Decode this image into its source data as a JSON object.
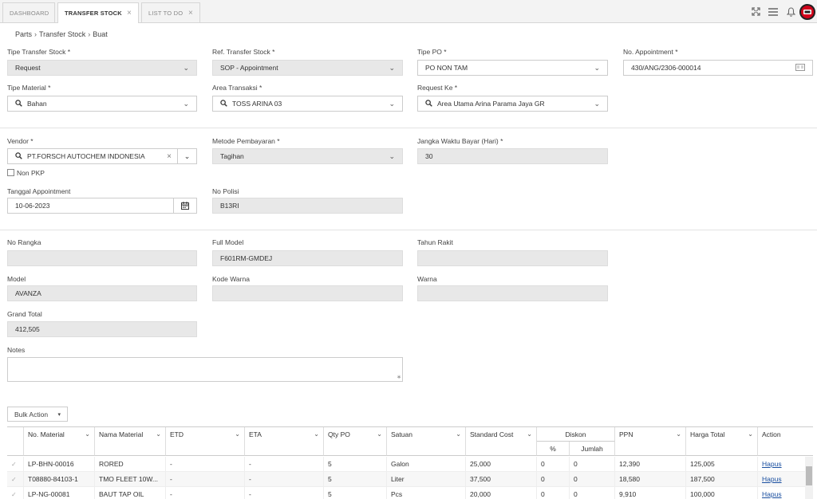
{
  "tabs": [
    {
      "label": "DASHBOARD"
    },
    {
      "label": "TRANSFER STOCK",
      "close": "×"
    },
    {
      "label": "LIST TO DO",
      "close": "×"
    }
  ],
  "breadcrumb": [
    "Parts",
    "Transfer Stock",
    "Buat"
  ],
  "form": {
    "tipe_transfer_stock": {
      "label": "Tipe Transfer Stock *",
      "value": "Request"
    },
    "ref_transfer_stock": {
      "label": "Ref. Transfer Stock *",
      "value": "SOP - Appointment"
    },
    "tipe_po": {
      "label": "Tipe PO *",
      "value": "PO NON TAM"
    },
    "no_appointment": {
      "label": "No. Appointment *",
      "value": "430/ANG/2306-000014"
    },
    "tipe_material": {
      "label": "Tipe Material *",
      "value": "Bahan"
    },
    "area_transaksi": {
      "label": "Area Transaksi *",
      "value": "TOSS ARINA 03"
    },
    "request_ke": {
      "label": "Request Ke *",
      "value": "Area Utama Arina Parama Jaya GR"
    },
    "vendor": {
      "label": "Vendor *",
      "value": "PT.FORSCH AUTOCHEM INDONESIA",
      "clear": "×"
    },
    "metode_pembayaran": {
      "label": "Metode Pembayaran *",
      "value": "Tagihan"
    },
    "jangka_waktu": {
      "label": "Jangka Waktu Bayar (Hari) *",
      "value": "30"
    },
    "non_pkp": {
      "label": "Non PKP",
      "checked": false
    },
    "tanggal_appointment": {
      "label": "Tanggal Appointment",
      "value": "10-06-2023"
    },
    "no_polisi": {
      "label": "No Polisi",
      "value": "B13RI"
    },
    "no_rangka": {
      "label": "No Rangka",
      "value": ""
    },
    "full_model": {
      "label": "Full Model",
      "value": "F601RM-GMDEJ"
    },
    "tahun_rakit": {
      "label": "Tahun Rakit",
      "value": ""
    },
    "model": {
      "label": "Model",
      "value": "AVANZA"
    },
    "kode_warna": {
      "label": "Kode Warna",
      "value": ""
    },
    "warna": {
      "label": "Warna",
      "value": ""
    },
    "grand_total": {
      "label": "Grand Total",
      "value": "412,505"
    },
    "notes": {
      "label": "Notes",
      "value": ""
    }
  },
  "bulk_action": {
    "label": "Bulk Action"
  },
  "table": {
    "headers": {
      "no_material": "No. Material",
      "nama_material": "Nama Material",
      "etd": "ETD",
      "eta": "ETA",
      "qty_po": "Qty PO",
      "satuan": "Satuan",
      "standard_cost": "Standard Cost",
      "diskon": "Diskon",
      "diskon_pct": "%",
      "diskon_jumlah": "Jumlah",
      "ppn": "PPN",
      "harga_total": "Harga Total",
      "action": "Action"
    },
    "rows": [
      {
        "no_material": "LP-BHN-00016",
        "nama_material": "RORED",
        "etd": "-",
        "eta": "-",
        "qty_po": "5",
        "satuan": "Galon",
        "standard_cost": "25,000",
        "diskon_pct": "0",
        "diskon_jumlah": "0",
        "ppn": "12,390",
        "harga_total": "125,005",
        "action": "Hapus"
      },
      {
        "no_material": "T08880-84103-1",
        "nama_material": "TMO FLEET 10W...",
        "etd": "-",
        "eta": "-",
        "qty_po": "5",
        "satuan": "Liter",
        "standard_cost": "37,500",
        "diskon_pct": "0",
        "diskon_jumlah": "0",
        "ppn": "18,580",
        "harga_total": "187,500",
        "action": "Hapus"
      },
      {
        "no_material": "LP-NG-00081",
        "nama_material": "BAUT TAP OIL",
        "etd": "-",
        "eta": "-",
        "qty_po": "5",
        "satuan": "Pcs",
        "standard_cost": "20,000",
        "diskon_pct": "0",
        "diskon_jumlah": "0",
        "ppn": "9,910",
        "harga_total": "100,000",
        "action": "Hapus"
      }
    ]
  }
}
